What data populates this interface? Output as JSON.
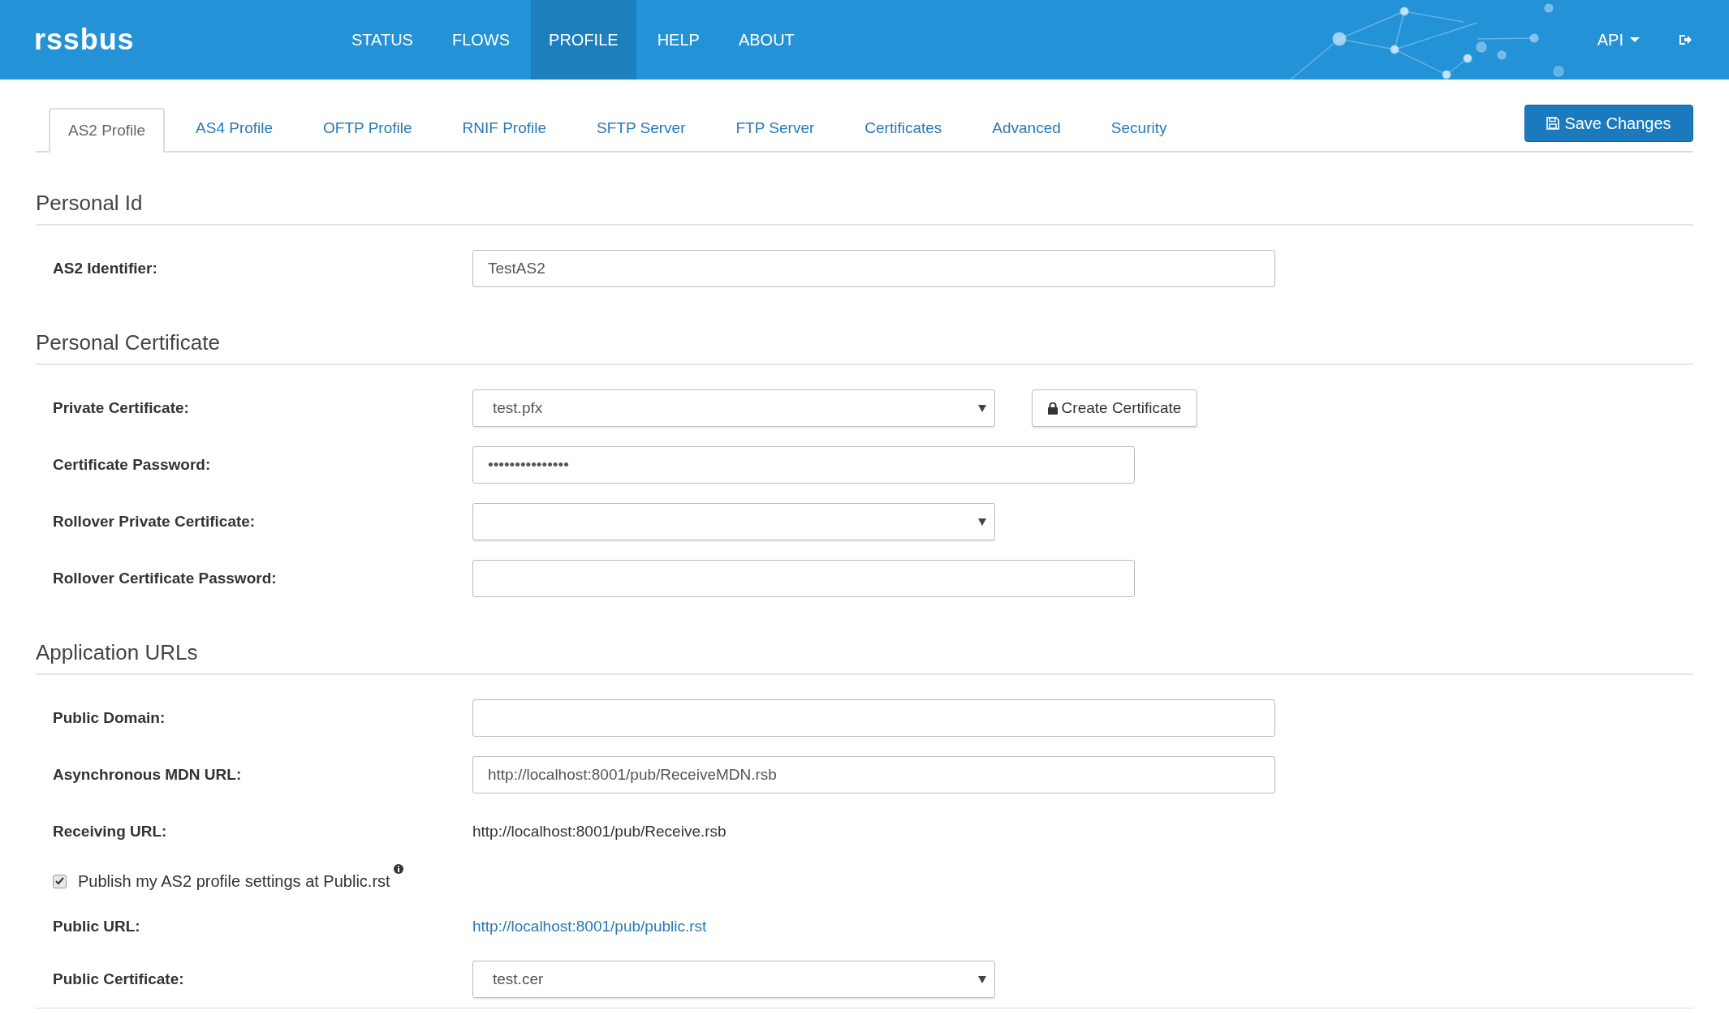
{
  "header": {
    "logo": "rssbus",
    "nav": [
      {
        "label": "STATUS",
        "selected": false
      },
      {
        "label": "FLOWS",
        "selected": false
      },
      {
        "label": "PROFILE",
        "selected": true
      },
      {
        "label": "HELP",
        "selected": false
      },
      {
        "label": "ABOUT",
        "selected": false
      }
    ],
    "api_menu": "API"
  },
  "tabs": [
    {
      "label": "AS2 Profile",
      "selected": true
    },
    {
      "label": "AS4 Profile",
      "selected": false
    },
    {
      "label": "OFTP Profile",
      "selected": false
    },
    {
      "label": "RNIF Profile",
      "selected": false
    },
    {
      "label": "SFTP Server",
      "selected": false
    },
    {
      "label": "FTP Server",
      "selected": false
    },
    {
      "label": "Certificates",
      "selected": false
    },
    {
      "label": "Advanced",
      "selected": false
    },
    {
      "label": "Security",
      "selected": false
    }
  ],
  "save_button": "Save Changes",
  "sections": [
    {
      "title": "Personal Id",
      "rows": [
        {
          "kind": "input",
          "label": "AS2 Identifier:",
          "value": "TestAS2"
        }
      ]
    },
    {
      "title": "Personal Certificate",
      "rows": [
        {
          "kind": "select",
          "label": "Private Certificate:",
          "value": "test.pfx",
          "button": "Create Certificate"
        },
        {
          "kind": "password",
          "label": "Certificate Password:",
          "value": "•••••••••••••••"
        },
        {
          "kind": "select",
          "label": "Rollover Private Certificate:"
        },
        {
          "kind": "password",
          "label": "Rollover Certificate Password:"
        }
      ]
    },
    {
      "title": "Application URLs",
      "rows": [
        {
          "kind": "input",
          "label": "Public Domain:"
        },
        {
          "kind": "input",
          "label": "Asynchronous MDN URL:",
          "value": "http://localhost:8001/pub/ReceiveMDN.rsb"
        },
        {
          "kind": "text",
          "label": "Receiving URL:",
          "value": "http://localhost:8001/pub/Receive.rsb"
        },
        {
          "kind": "checkbox",
          "label": "Publish my AS2 profile settings at Public.rst",
          "checked": true
        },
        {
          "kind": "link",
          "label": "Public URL:",
          "value": "http://localhost:8001/pub/public.rst"
        },
        {
          "kind": "select",
          "label": "Public Certificate:",
          "value": "test.cer"
        }
      ]
    }
  ]
}
